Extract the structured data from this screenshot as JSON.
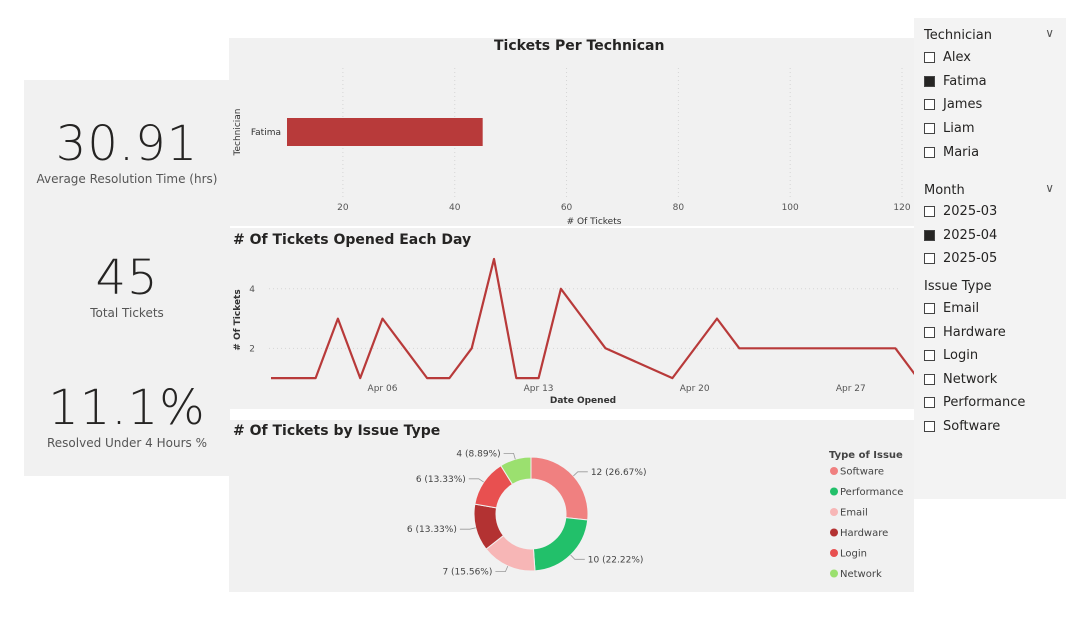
{
  "kpis": [
    {
      "value": "30.91",
      "label": "Average Resolution Time (hrs)"
    },
    {
      "value": "45",
      "label": "Total Tickets"
    },
    {
      "value": "11.1%",
      "label": "Resolved Under 4 Hours %"
    }
  ],
  "bar_chart": {
    "title": "Tickets Per Technican",
    "ylabel": "Technician",
    "xlabel": "# Of Tickets",
    "ticks": [
      "20",
      "40",
      "60",
      "80",
      "100",
      "120"
    ]
  },
  "line_chart": {
    "title": "# Of Tickets Opened Each Day",
    "ylabel": "# Of Tickets",
    "xlabel": "Date Opened",
    "yticks": [
      "2",
      "4"
    ],
    "xticks": [
      "Apr 06",
      "Apr 13",
      "Apr 20",
      "Apr 27"
    ]
  },
  "pie_chart": {
    "title": "# Of Tickets by Issue Type",
    "legend_title": "Type of Issue"
  },
  "chart_data": [
    {
      "type": "bar",
      "orientation": "horizontal",
      "title": "Tickets Per Technican",
      "xlabel": "# Of Tickets",
      "ylabel": "Technician",
      "categories": [
        "Fatima"
      ],
      "values": [
        45
      ],
      "xlim": [
        10,
        120
      ],
      "color": "#b83a3a"
    },
    {
      "type": "line",
      "title": "# Of Tickets Opened Each Day",
      "xlabel": "Date Opened",
      "ylabel": "# Of Tickets",
      "x": [
        "2025-04-01",
        "2025-04-02",
        "2025-04-03",
        "2025-04-04",
        "2025-04-05",
        "2025-04-06",
        "2025-04-07",
        "2025-04-08",
        "2025-04-09",
        "2025-04-10",
        "2025-04-11",
        "2025-04-12",
        "2025-04-13",
        "2025-04-14",
        "2025-04-15",
        "2025-04-16",
        "2025-04-19",
        "2025-04-21",
        "2025-04-22",
        "2025-04-23",
        "2025-04-24",
        "2025-04-29",
        "2025-04-30"
      ],
      "y": [
        1,
        1,
        1,
        3,
        1,
        3,
        2,
        1,
        1,
        2,
        5,
        1,
        1,
        4,
        3,
        2,
        1,
        3,
        2,
        2,
        2,
        2,
        1
      ],
      "ylim": [
        0.5,
        5
      ],
      "color": "#b83a3a"
    },
    {
      "type": "pie",
      "title": "# Of Tickets by Issue Type",
      "donut": true,
      "legend_title": "Type of Issue",
      "slices": [
        {
          "name": "Software",
          "value": 12,
          "label": "12 (26.67%)",
          "color": "#f08080"
        },
        {
          "name": "Performance",
          "value": 10,
          "label": "10 (22.22%)",
          "color": "#22c06a"
        },
        {
          "name": "Email",
          "value": 7,
          "label": "7 (15.56%)",
          "color": "#f7b6b6"
        },
        {
          "name": "Hardware",
          "value": 6,
          "label": "6 (13.33%)",
          "color": "#b33232"
        },
        {
          "name": "Login",
          "value": 6,
          "label": "6 (13.33%)",
          "color": "#e85050"
        },
        {
          "name": "Network",
          "value": 4,
          "label": "4 (8.89%)",
          "color": "#9be06f"
        }
      ]
    }
  ],
  "slicers": {
    "technician": {
      "title": "Technician",
      "items": [
        {
          "label": "Alex",
          "checked": false
        },
        {
          "label": "Fatima",
          "checked": true
        },
        {
          "label": "James",
          "checked": false
        },
        {
          "label": "Liam",
          "checked": false
        },
        {
          "label": "Maria",
          "checked": false
        }
      ]
    },
    "month": {
      "title": "Month",
      "items": [
        {
          "label": "2025-03",
          "checked": false
        },
        {
          "label": "2025-04",
          "checked": true
        },
        {
          "label": "2025-05",
          "checked": false
        }
      ]
    },
    "issue_type": {
      "title": "Issue Type",
      "items": [
        {
          "label": "Email",
          "checked": false
        },
        {
          "label": "Hardware",
          "checked": false
        },
        {
          "label": "Login",
          "checked": false
        },
        {
          "label": "Network",
          "checked": false
        },
        {
          "label": "Performance",
          "checked": false
        },
        {
          "label": "Software",
          "checked": false
        }
      ]
    }
  }
}
